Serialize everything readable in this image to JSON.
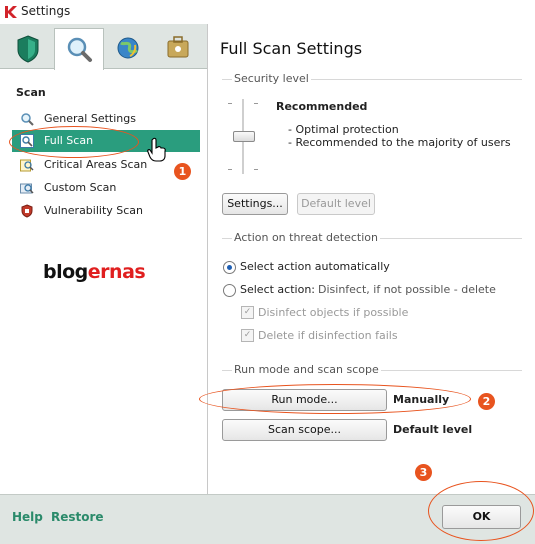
{
  "window": {
    "title": "Settings"
  },
  "left": {
    "tabs": [
      {
        "icon": "shield-icon"
      },
      {
        "icon": "magnifier-icon",
        "active": true
      },
      {
        "icon": "globe-icon"
      },
      {
        "icon": "briefcase-icon"
      }
    ],
    "section_title": "Scan",
    "items": [
      {
        "label": "General Settings",
        "icon": "magnifier-icon"
      },
      {
        "label": "Full Scan",
        "icon": "full-scan-icon",
        "selected": true
      },
      {
        "label": "Critical Areas Scan",
        "icon": "critical-scan-icon"
      },
      {
        "label": "Custom Scan",
        "icon": "custom-scan-icon"
      },
      {
        "label": "Vulnerability Scan",
        "icon": "vulnerability-icon"
      }
    ],
    "brand": {
      "part1": "blog",
      "part2": "ernas"
    }
  },
  "main": {
    "title": "Full Scan Settings",
    "security_level": {
      "legend": "Security level",
      "level_name": "Recommended",
      "desc1": "- Optimal protection",
      "desc2": "- Recommended to the majority of users",
      "settings_button": "Settings...",
      "default_button": "Default level"
    },
    "threat": {
      "legend": "Action on threat detection",
      "radio_auto": "Select action automatically",
      "radio_manual_label": "Select action:",
      "radio_manual_value": "Disinfect, if not possible - delete",
      "check_disinfect": "Disinfect objects if possible",
      "check_delete": "Delete if disinfection fails"
    },
    "run": {
      "legend": "Run mode and scan scope",
      "run_mode_button": "Run mode...",
      "run_mode_value": "Manually",
      "scan_scope_button": "Scan scope...",
      "scan_scope_value": "Default level"
    }
  },
  "footer": {
    "help": "Help",
    "restore": "Restore",
    "ok": "OK"
  },
  "annotations": [
    "1",
    "2",
    "3"
  ],
  "colors": {
    "accent": "#2a9d7e",
    "annotation": "#e8541f"
  }
}
